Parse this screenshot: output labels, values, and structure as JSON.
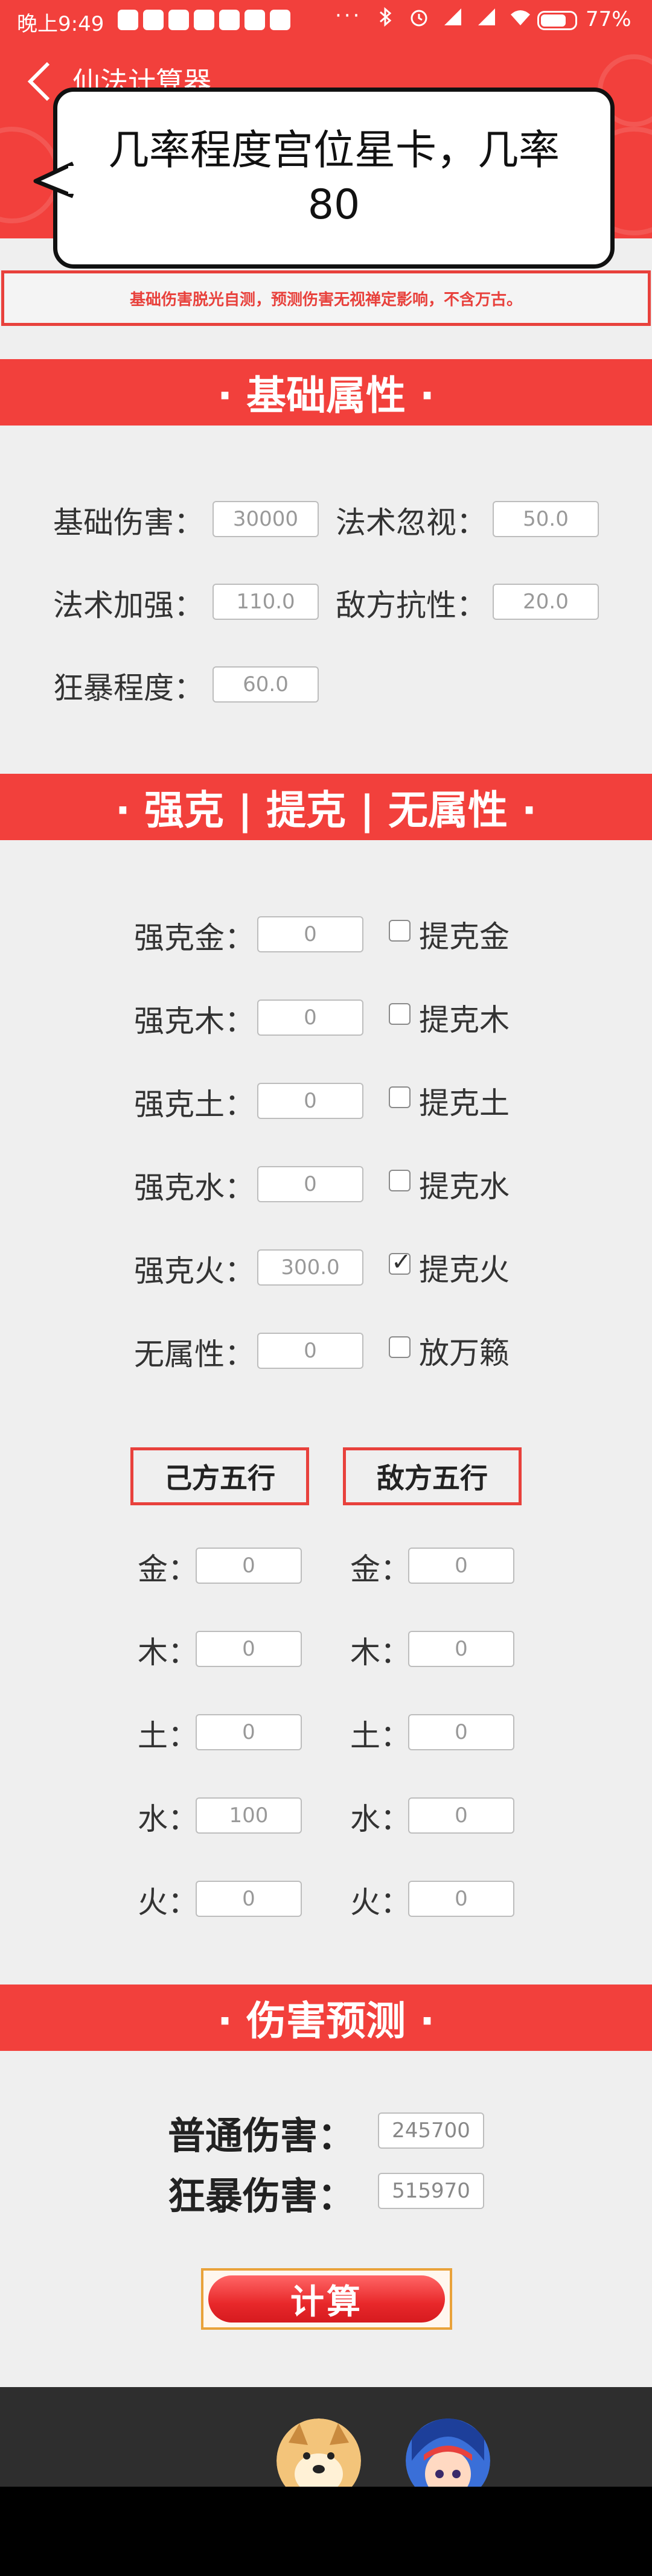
{
  "status_bar": {
    "time": "晚上9:49",
    "battery": "77%",
    "dots": "···"
  },
  "header": {
    "title": "仙法计算器"
  },
  "tooltip": {
    "text": "几率程度宫位星卡，几率80"
  },
  "notice": {
    "text": "基础伤害脱光自测，预测伤害无视禅定影响，不含万古。"
  },
  "sections": {
    "basic": "· 基础属性 ·",
    "restrain": "· 强克 | 提克 | 无属性 ·",
    "predict": "· 伤害预测 ·"
  },
  "basic": {
    "base_damage": {
      "label": "基础伤害：",
      "value": "30000"
    },
    "spell_ignore": {
      "label": "法术忽视：",
      "value": "50.0"
    },
    "spell_boost": {
      "label": "法术加强：",
      "value": "110.0"
    },
    "enemy_resist": {
      "label": "敌方抗性：",
      "value": "20.0"
    },
    "crit_level": {
      "label": "狂暴程度：",
      "value": "60.0"
    }
  },
  "restrain": [
    {
      "label": "强克金：",
      "value": "0",
      "check_label": "提克金",
      "checked": false
    },
    {
      "label": "强克木：",
      "value": "0",
      "check_label": "提克木",
      "checked": false
    },
    {
      "label": "强克土：",
      "value": "0",
      "check_label": "提克土",
      "checked": false
    },
    {
      "label": "强克水：",
      "value": "0",
      "check_label": "提克水",
      "checked": false
    },
    {
      "label": "强克火：",
      "value": "300.0",
      "check_label": "提克火",
      "checked": true
    },
    {
      "label": "无属性：",
      "value": "0",
      "check_label": "放万籁",
      "checked": false
    }
  ],
  "elements": {
    "self_title": "己方五行",
    "enemy_title": "敌方五行",
    "self": [
      {
        "label": "金：",
        "value": "0"
      },
      {
        "label": "木：",
        "value": "0"
      },
      {
        "label": "土：",
        "value": "0"
      },
      {
        "label": "水：",
        "value": "100"
      },
      {
        "label": "火：",
        "value": "0"
      }
    ],
    "enemy": [
      {
        "label": "金：",
        "value": "0"
      },
      {
        "label": "木：",
        "value": "0"
      },
      {
        "label": "土：",
        "value": "0"
      },
      {
        "label": "水：",
        "value": "0"
      },
      {
        "label": "火：",
        "value": "0"
      }
    ]
  },
  "prediction": {
    "normal": {
      "label": "普通伤害：",
      "value": "245700"
    },
    "crit": {
      "label": "狂暴伤害：",
      "value": "515970"
    }
  },
  "calc_button": "计算",
  "colors": {
    "accent": "#f2403c",
    "notice": "#e8413c",
    "button_border": "#e9a23a"
  },
  "icons": [
    "back-arrow-icon",
    "checkbox-icon",
    "doge-avatar-icon",
    "character-avatar-icon"
  ]
}
